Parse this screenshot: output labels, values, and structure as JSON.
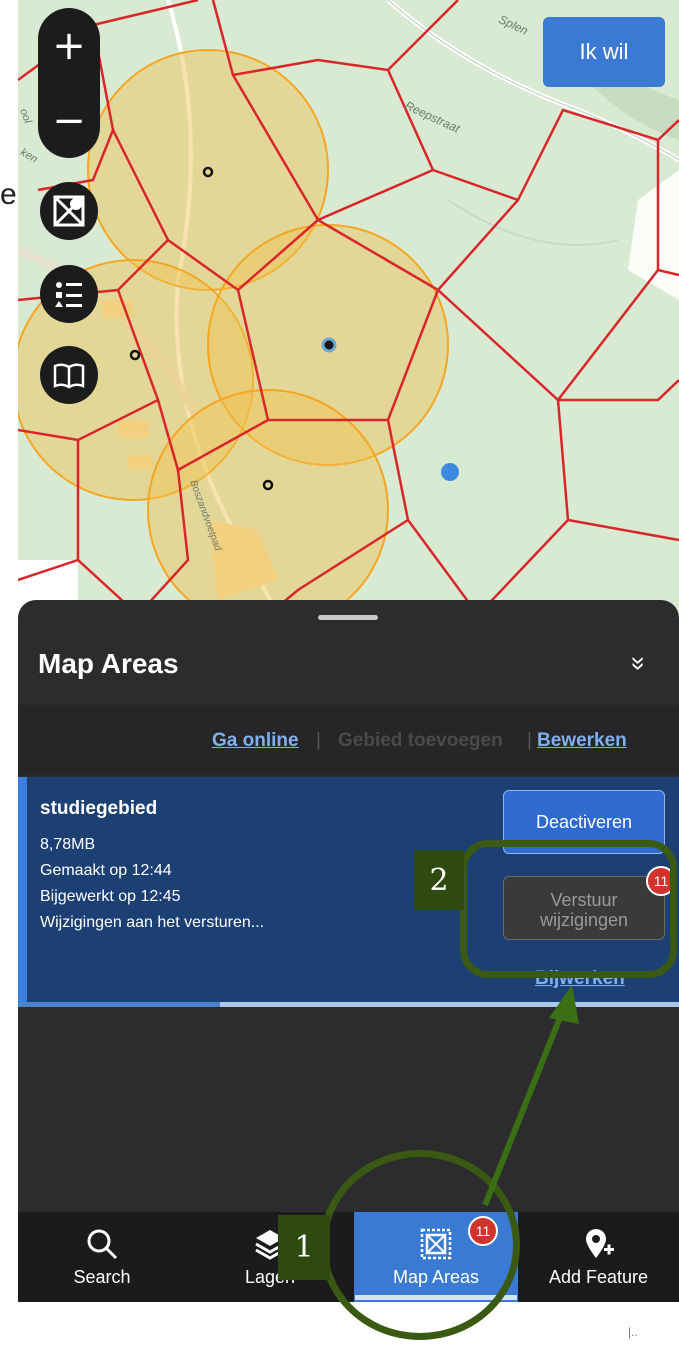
{
  "map": {
    "road_labels": [
      "Splen",
      "Reepstraat",
      "Boszandvoetpad"
    ],
    "left_edge_letters": [
      "ool",
      "ken"
    ],
    "edge_glyph": "e"
  },
  "map_controls": {
    "zoom_in": "+",
    "zoom_out": "−",
    "buttons": [
      "map-areas-icon",
      "legend-list-icon",
      "book-icon"
    ]
  },
  "top_right_button": "Ik wil",
  "sheet": {
    "title": "Map Areas",
    "collapse_icon": "»",
    "toolbar": {
      "go_online": "Ga online",
      "separator": "|",
      "add_area": "Gebied toevoegen",
      "edit": "Bewerken"
    },
    "area": {
      "name": "studiegebied",
      "size": "8,78MB",
      "created": "Gemaakt op 12:44",
      "updated": "Bijgewerkt op 12:45",
      "status": "Wijzigingen aan het versturen...",
      "deactivate_button": "Deactiveren",
      "send_button_line1": "Verstuur",
      "send_button_line2": "wijzigingen",
      "send_badge": "11",
      "update_link": "Bijwerken"
    }
  },
  "annotations": {
    "label_1": "1",
    "label_2": "2"
  },
  "bottom_nav": {
    "items": [
      {
        "label": "Search",
        "icon": "search-icon"
      },
      {
        "label": "Lagen",
        "icon": "layers-icon"
      },
      {
        "label": "Map Areas",
        "icon": "map-areas-icon",
        "badge": "11",
        "active": true
      },
      {
        "label": "Add Feature",
        "icon": "add-location-icon"
      }
    ]
  },
  "colors": {
    "accent": "#3b7ad3",
    "annotation_green": "#3a5a14",
    "hex_grid": "#d9262a",
    "buffer_fill": "#f2c85b",
    "badge": "#d0342c"
  }
}
